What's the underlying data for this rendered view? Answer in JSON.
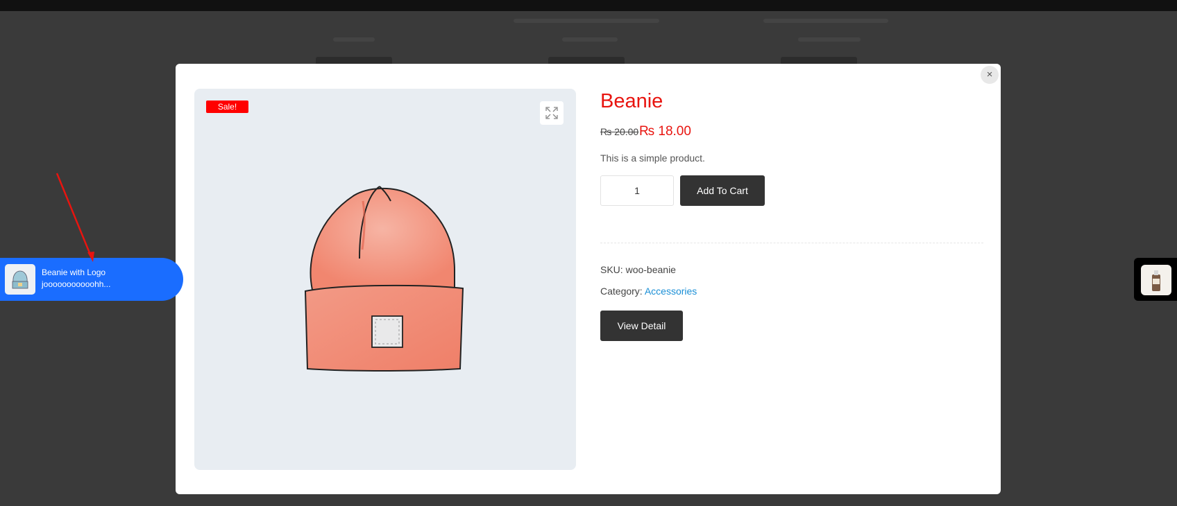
{
  "product": {
    "title": "Beanie",
    "price_old": "₨ 20.00",
    "price_new": "₨ 18.00",
    "short_description": "This is a simple product.",
    "quantity": "1",
    "add_to_cart_label": "Add To Cart",
    "sku_label": "SKU:",
    "sku_value": "woo-beanie",
    "category_label": "Category:",
    "category_value": "Accessories",
    "view_detail_label": "View Detail",
    "sale_badge": "Sale!"
  },
  "modal": {
    "close_label": "×"
  },
  "notification": {
    "title": "Beanie with Logo",
    "subtitle": "jooooooooooohh..."
  },
  "colors": {
    "title_red": "#e8140f",
    "notification_blue": "#1a6dff",
    "button_dark": "#333333",
    "link_blue": "#1a8fd6",
    "sale_red": "#ff0000"
  },
  "icons": {
    "zoom": "expand-icon",
    "close": "close-icon"
  }
}
